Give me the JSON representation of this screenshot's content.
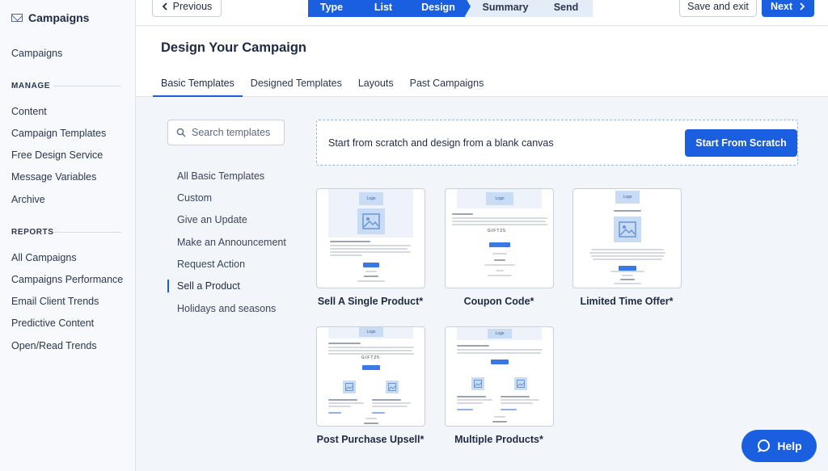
{
  "sidebar": {
    "title": "Campaigns",
    "top_link": "Campaigns",
    "manage_heading": "MANAGE",
    "manage_items": [
      "Content",
      "Campaign Templates",
      "Free Design Service",
      "Message Variables",
      "Archive"
    ],
    "reports_heading": "REPORTS",
    "reports_items": [
      "All Campaigns",
      "Campaigns Performance",
      "Email Client Trends",
      "Predictive Content",
      "Open/Read Trends"
    ]
  },
  "topbar": {
    "previous_label": "Previous",
    "steps": [
      "Type",
      "List",
      "Design",
      "Summary",
      "Send"
    ],
    "active_steps": 3,
    "save_label": "Save and exit",
    "next_label": "Next"
  },
  "header": {
    "title": "Design Your Campaign",
    "tabs": [
      "Basic Templates",
      "Designed Templates",
      "Layouts",
      "Past Campaigns"
    ],
    "active_tab": "Basic Templates"
  },
  "search": {
    "placeholder": "Search templates"
  },
  "categories": [
    "All Basic Templates",
    "Custom",
    "Give an Update",
    "Make an Announcement",
    "Request Action",
    "Sell a Product",
    "Holidays and seasons"
  ],
  "selected_category": "Sell a Product",
  "scratch": {
    "text": "Start from scratch and design from a blank canvas",
    "button": "Start From Scratch"
  },
  "templates": [
    {
      "name": "Sell A Single Product*",
      "logo": "Logo"
    },
    {
      "name": "Coupon Code*",
      "logo": "Logo",
      "code": "GIFT25"
    },
    {
      "name": "Limited Time Offer*",
      "logo": "Logo"
    },
    {
      "name": "Post Purchase Upsell*",
      "logo": "Logo",
      "code": "GIFT25"
    },
    {
      "name": "Multiple Products*",
      "logo": "Logo"
    }
  ],
  "help_label": "Help",
  "colors": {
    "accent": "#1a5fe0",
    "thumb": "#c9dcf5"
  }
}
